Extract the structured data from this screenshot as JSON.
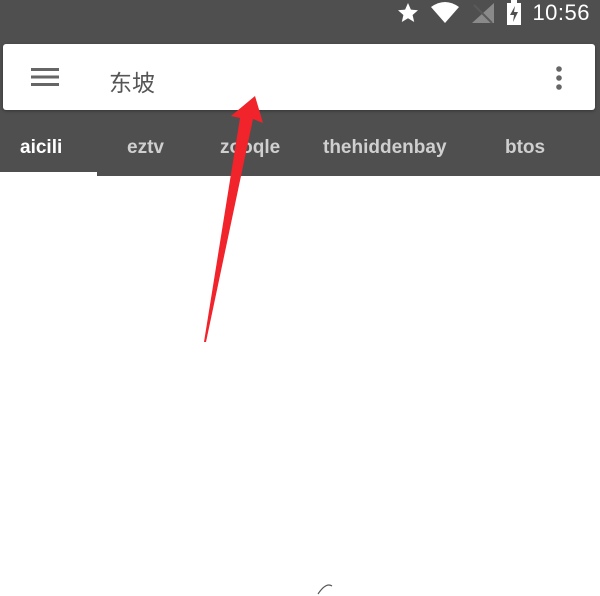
{
  "status_bar": {
    "time": "10:56",
    "icons": [
      "star-icon",
      "wifi-icon",
      "signal-icon",
      "battery-charging-icon"
    ]
  },
  "search": {
    "query": "东坡",
    "menu_icon": "hamburger-menu-icon",
    "more_icon": "more-vertical-icon"
  },
  "tabs": [
    {
      "label": "aicili",
      "active": true
    },
    {
      "label": "eztv",
      "active": false
    },
    {
      "label": "zooqle",
      "active": false
    },
    {
      "label": "thehiddenbay",
      "active": false
    },
    {
      "label": "btos",
      "active": false
    }
  ],
  "colors": {
    "toolbar": "#4f4f4f",
    "annotation_arrow": "#f0242a"
  }
}
